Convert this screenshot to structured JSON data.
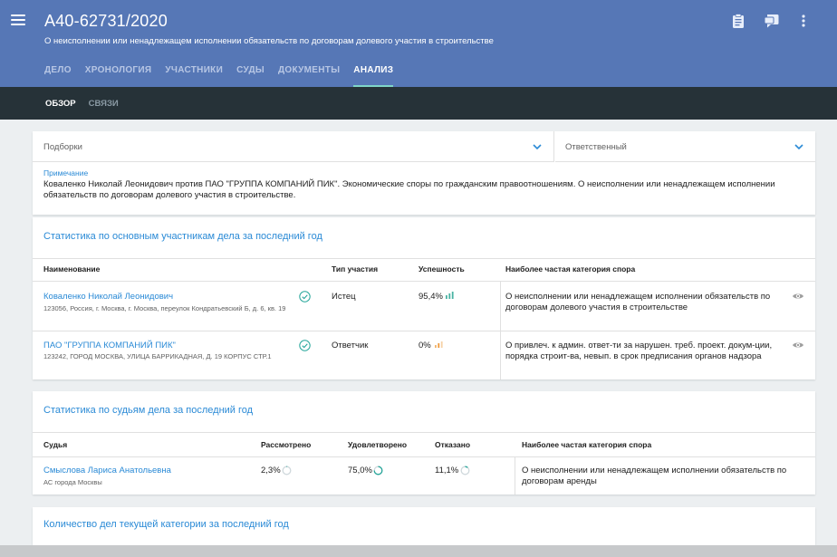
{
  "header": {
    "case_number": "А40-62731/2020",
    "case_subject": "О неисполнении или ненадлежащем исполнении обязательств по договорам долевого участия в строительстве",
    "tabs": [
      "ДЕЛО",
      "ХРОНОЛОГИЯ",
      "УЧАСТНИКИ",
      "СУДЫ",
      "ДОКУМЕНТЫ",
      "АНАЛИЗ"
    ],
    "active_tab": "АНАЛИЗ",
    "icons": [
      "clipboard-icon",
      "comments-icon",
      "more-vert-icon",
      "menu-icon"
    ]
  },
  "subtabs": {
    "items": [
      "ОБЗОР",
      "СВЯЗИ"
    ],
    "active": "ОБЗОР"
  },
  "filters": {
    "collections_label": "Подборки",
    "responsible_label": "Ответственный",
    "note_label": "Примечание",
    "note_text": "Коваленко Николай Леонидович против ПАО \"ГРУППА КОМПАНИЙ ПИК\". Экономические споры по гражданским правоотношениям. О неисполнении или ненадлежащем исполнении обязательств по договорам долевого участия в строительстве."
  },
  "participants": {
    "title": "Статистика по основным участникам дела за последний год",
    "columns": [
      "Наименование",
      "Тип участия",
      "Успешность",
      "Наиболее частая категория спора"
    ],
    "rows": [
      {
        "name": "Коваленко Николай Леонидович",
        "address": "123056, Россия, г. Москва, г. Москва, переулок Кондратьевский Б, д. 6, кв. 19",
        "role": "Истец",
        "success": "95,4%",
        "category": "О неисполнении или ненадлежащем исполнении обязательств по договорам долевого участия в строительстве"
      },
      {
        "name": "ПАО \"ГРУППА КОМПАНИЙ ПИК\"",
        "address": "123242, ГОРОД МОСКВА, УЛИЦА БАРРИКАДНАЯ, Д. 19 КОРПУС СТР.1",
        "role": "Ответчик",
        "success": "0%",
        "category": "О привлеч. к админ. ответ-ти за нарушен. треб. проект. докум-ции, порядка строит-ва, невып. в срок предписания органов надзора"
      }
    ]
  },
  "judges": {
    "title": "Статистика по судьям дела за последний год",
    "columns": [
      "Судья",
      "Рассмотрено",
      "Удовлетворено",
      "Отказано",
      "Наиболее частая категория спора"
    ],
    "rows": [
      {
        "name": "Смыслова Лариса Анатольевна",
        "court": "АС города Москвы",
        "considered": "2,3%",
        "satisfied": "75,0%",
        "refused": "11,1%",
        "category": "О неисполнении или ненадлежащем исполнении обязательств по договорам аренды"
      }
    ]
  },
  "count_section": {
    "title": "Количество дел текущей категории за последний год"
  },
  "colors": {
    "header": "#5677b6",
    "subbar": "#263238",
    "accent": "#2a8ad6",
    "teal": "#26a69a",
    "orange": "#ef9a3a"
  }
}
